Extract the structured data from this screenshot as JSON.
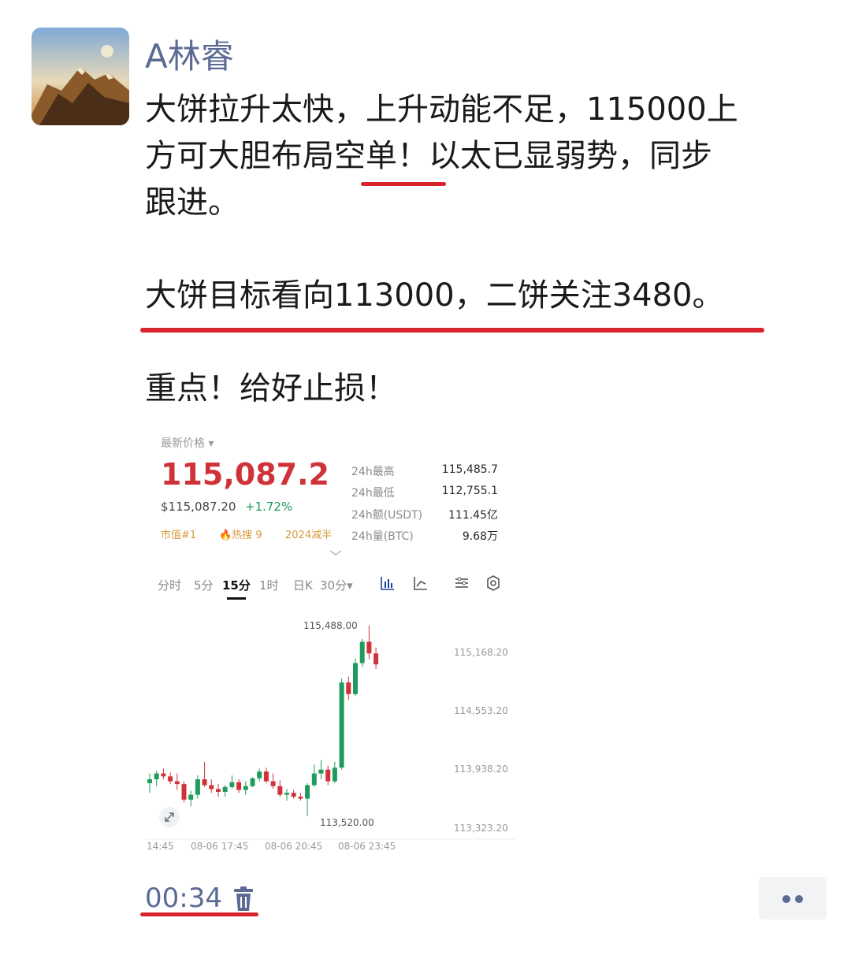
{
  "post": {
    "author": "A林睿",
    "line1": "大饼拉升太快，上升动能不足，115000上",
    "line2": "方可大胆布局空单！以太已显弱势，同步",
    "line3": "跟进。",
    "line4": "大饼目标看向113000，二饼关注3480。",
    "line5": "重点！给好止损！",
    "time": "00:34",
    "accent_color": "#d8242b",
    "name_color": "#5b6b93"
  },
  "ticker": {
    "header": "最新价格 ▾",
    "price": "115,087.2",
    "usd_price": "$115,087.20",
    "change": "+1.72%",
    "tags": [
      "市值#1",
      "🔥热搜 9",
      "2024减半"
    ],
    "stats": [
      {
        "label": "24h最高",
        "value": "115,485.7"
      },
      {
        "label": "24h最低",
        "value": "112,755.1"
      },
      {
        "label": "24h额(USDT)",
        "value": "111.45亿"
      },
      {
        "label": "24h量(BTC)",
        "value": "9.68万"
      }
    ],
    "tabs": [
      "分时",
      "5分",
      "15分",
      "1时",
      "日K",
      "30分▾"
    ],
    "active_tab": "15分"
  },
  "chart_data": {
    "type": "candlestick",
    "y_ticks": [
      "115,168.20",
      "114,553.20",
      "113,938.20",
      "113,323.20"
    ],
    "x_ticks": [
      "14:45",
      "08-06 17:45",
      "08-06 20:45",
      "08-06 23:45"
    ],
    "high_annotation": "115,488.00",
    "low_annotation": "113,520.00",
    "ylim": [
      113200,
      115560
    ],
    "candles": [
      {
        "o": 113860,
        "h": 113960,
        "l": 113760,
        "c": 113900
      },
      {
        "o": 113900,
        "h": 113990,
        "l": 113830,
        "c": 113960
      },
      {
        "o": 113960,
        "h": 114010,
        "l": 113900,
        "c": 113930
      },
      {
        "o": 113930,
        "h": 113970,
        "l": 113850,
        "c": 113880
      },
      {
        "o": 113880,
        "h": 113960,
        "l": 113790,
        "c": 113850
      },
      {
        "o": 113850,
        "h": 113880,
        "l": 113660,
        "c": 113690
      },
      {
        "o": 113690,
        "h": 113780,
        "l": 113620,
        "c": 113740
      },
      {
        "o": 113740,
        "h": 113940,
        "l": 113700,
        "c": 113900
      },
      {
        "o": 113900,
        "h": 114080,
        "l": 113820,
        "c": 113840
      },
      {
        "o": 113840,
        "h": 113900,
        "l": 113760,
        "c": 113800
      },
      {
        "o": 113800,
        "h": 113850,
        "l": 113720,
        "c": 113770
      },
      {
        "o": 113770,
        "h": 113840,
        "l": 113720,
        "c": 113820
      },
      {
        "o": 113820,
        "h": 113940,
        "l": 113800,
        "c": 113870
      },
      {
        "o": 113870,
        "h": 113900,
        "l": 113760,
        "c": 113790
      },
      {
        "o": 113790,
        "h": 113880,
        "l": 113740,
        "c": 113830
      },
      {
        "o": 113830,
        "h": 113920,
        "l": 113820,
        "c": 113910
      },
      {
        "o": 113910,
        "h": 114010,
        "l": 113880,
        "c": 113980
      },
      {
        "o": 113980,
        "h": 114020,
        "l": 113860,
        "c": 113880
      },
      {
        "o": 113880,
        "h": 113960,
        "l": 113800,
        "c": 113830
      },
      {
        "o": 113830,
        "h": 113890,
        "l": 113720,
        "c": 113740
      },
      {
        "o": 113740,
        "h": 113800,
        "l": 113680,
        "c": 113760
      },
      {
        "o": 113760,
        "h": 113790,
        "l": 113700,
        "c": 113720
      },
      {
        "o": 113720,
        "h": 113760,
        "l": 113680,
        "c": 113700
      },
      {
        "o": 113700,
        "h": 113860,
        "l": 113520,
        "c": 113840
      },
      {
        "o": 113840,
        "h": 114050,
        "l": 113820,
        "c": 113960
      },
      {
        "o": 113960,
        "h": 114100,
        "l": 113900,
        "c": 114000
      },
      {
        "o": 114000,
        "h": 114040,
        "l": 113840,
        "c": 113880
      },
      {
        "o": 113880,
        "h": 114080,
        "l": 113860,
        "c": 114020
      },
      {
        "o": 114020,
        "h": 114940,
        "l": 114000,
        "c": 114900
      },
      {
        "o": 114900,
        "h": 114960,
        "l": 114720,
        "c": 114780
      },
      {
        "o": 114780,
        "h": 115150,
        "l": 114760,
        "c": 115100
      },
      {
        "o": 115100,
        "h": 115350,
        "l": 115060,
        "c": 115320
      },
      {
        "o": 115320,
        "h": 115488,
        "l": 115140,
        "c": 115200
      },
      {
        "o": 115200,
        "h": 115260,
        "l": 115040,
        "c": 115087
      }
    ]
  }
}
